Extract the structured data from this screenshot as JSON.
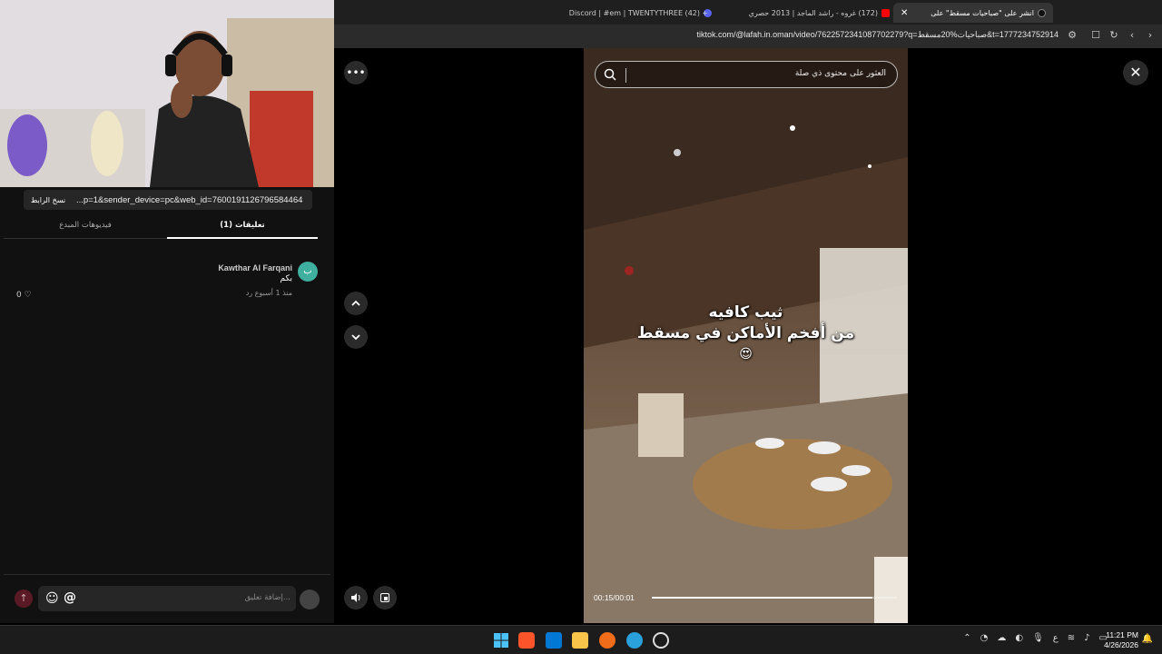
{
  "browser": {
    "tabs": [
      {
        "label": "انشر على \"صباحيات مسقط\" على",
        "active": true,
        "favicon_color": "#111111"
      },
      {
        "label": "(172) غروه - راشد الماجد | 2013 حصري",
        "active": false,
        "favicon_color": "#ff0000"
      },
      {
        "label": "(42) Discord | #em | TWENTYTHREE",
        "active": false,
        "favicon_color": "#5865f2"
      }
    ],
    "new_tab_label": "+",
    "url": "tiktok.com/@lafah.in.oman/video/7622572341087702279?q=صباحيات%20مسقط&t=1777234752914"
  },
  "left_panel": {
    "copy_link_label": "نسخ الرابط",
    "link_text": "...p=1&sender_device=pc&web_id=7600191126796584464",
    "tab_comments": "تعليقات (1)",
    "tab_creator_videos": "فيديوهات المبدع",
    "comment": {
      "author": "Kawthar Al Farqani",
      "text": "بكم",
      "avatar_initial": "ب",
      "meta": "منذ 1 أسبوع   رد",
      "like_count": "0 ♡"
    },
    "input_placeholder": "إضافة تعليق..."
  },
  "video": {
    "search_placeholder": "العثور على محتوى ذي صلة",
    "caption_line1": "ثيب كافيه",
    "caption_line2": "من أفخم الأماكن في مسقط",
    "caption_emoji": "😍",
    "timecode": "00:15/00:01",
    "progress": 0.9
  },
  "taskbar": {
    "clock_time": "11:21 PM",
    "clock_date": "4/26/2026",
    "tray_lang": "ع"
  }
}
